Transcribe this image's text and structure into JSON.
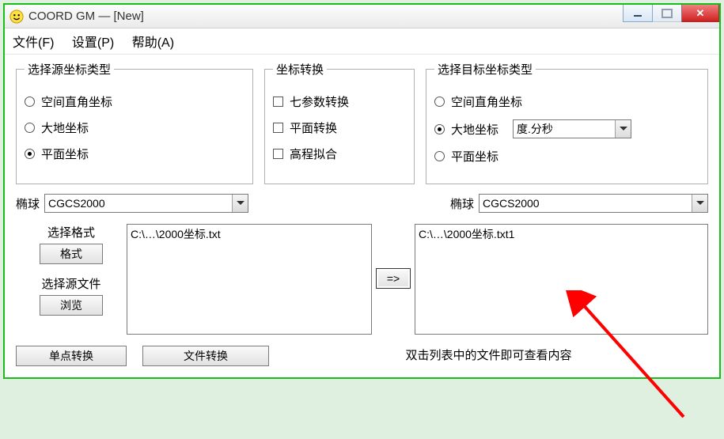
{
  "titlebar": {
    "title": "COORD GM — [New]"
  },
  "menu": {
    "file": "文件(F)",
    "settings": "设置(P)",
    "help": "帮助(A)"
  },
  "group_source": {
    "legend": "选择源坐标类型",
    "opt_space": "空间直角坐标",
    "opt_geo": "大地坐标",
    "opt_plane": "平面坐标",
    "selected": "plane"
  },
  "group_transform": {
    "legend": "坐标转换",
    "opt_seven": "七参数转换",
    "opt_plane": "平面转换",
    "opt_elev": "高程拟合"
  },
  "group_target": {
    "legend": "选择目标坐标类型",
    "opt_space": "空间直角坐标",
    "opt_geo": "大地坐标",
    "opt_plane": "平面坐标",
    "selected": "geo",
    "format_selected": "度.分秒"
  },
  "ellipsoid": {
    "label": "椭球",
    "source_value": "CGCS2000",
    "target_value": "CGCS2000"
  },
  "left_panel": {
    "format_label": "选择格式",
    "format_btn": "格式",
    "source_label": "选择源文件",
    "browse_btn": "浏览"
  },
  "source_list": {
    "item0": "C:\\…\\2000坐标.txt"
  },
  "target_list": {
    "item0": "C:\\…\\2000坐标.txt1"
  },
  "arrow_btn": "=>",
  "bottom": {
    "single_btn": "单点转换",
    "file_btn": "文件转换",
    "hint": "双击列表中的文件即可查看内容"
  }
}
